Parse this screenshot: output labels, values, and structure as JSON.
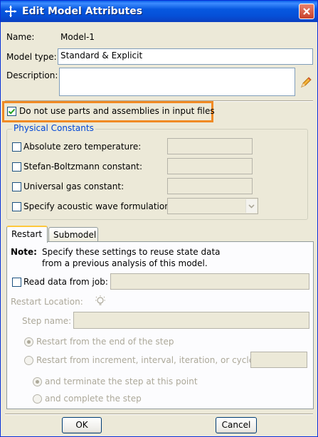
{
  "window": {
    "title": "Edit Model Attributes"
  },
  "name": {
    "label": "Name:",
    "value": "Model-1"
  },
  "model_type": {
    "label": "Model type:",
    "value": "Standard & Explicit"
  },
  "description": {
    "label": "Description:",
    "value": ""
  },
  "no_parts_option": {
    "label": "Do not use parts and assemblies in input files",
    "checked": true
  },
  "physical_constants": {
    "title": "Physical Constants",
    "items": [
      {
        "label": "Absolute zero temperature:",
        "value": ""
      },
      {
        "label": "Stefan-Boltzmann constant:",
        "value": ""
      },
      {
        "label": "Universal gas constant:",
        "value": ""
      },
      {
        "label": "Specify acoustic wave formulation:",
        "value": ""
      }
    ]
  },
  "tabs": [
    {
      "label": "Restart",
      "active": true
    },
    {
      "label": "Submodel",
      "active": false
    }
  ],
  "restart": {
    "note_label": "Note:",
    "note_line1": "Specify these settings to reuse state data",
    "note_line2": "from a previous analysis of this model.",
    "read_data_label": "Read data from job:",
    "read_data_value": "",
    "location_label": "Restart Location:",
    "step_name_label": "Step name:",
    "step_name_value": "",
    "opt_end_label": "Restart from the end of the step",
    "opt_increment_label": "Restart from increment, interval, iteration, or cycle:",
    "increment_value": "",
    "sub_terminate_label": "and terminate the step at this point",
    "sub_complete_label": "and complete the step"
  },
  "buttons": {
    "ok": "OK",
    "cancel": "Cancel"
  },
  "colors": {
    "title_bar": "#0758e0",
    "highlight": "#f08a24",
    "group_title": "#0046d5"
  }
}
